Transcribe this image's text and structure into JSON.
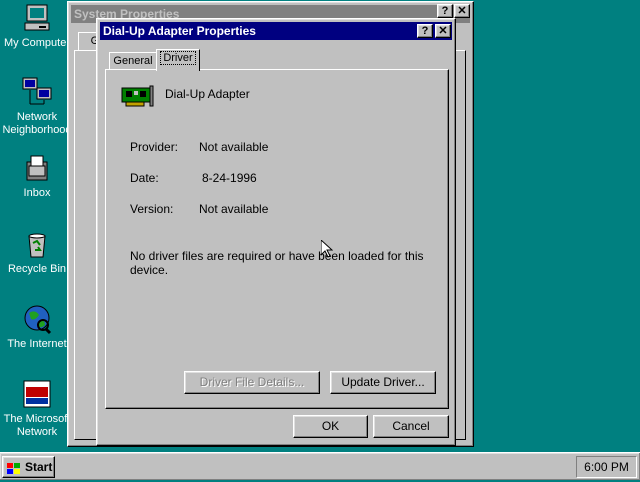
{
  "desktop": {
    "icons": [
      {
        "label": "My Computer"
      },
      {
        "label": "Network Neighborhood"
      },
      {
        "label": "Inbox"
      },
      {
        "label": "Recycle Bin"
      },
      {
        "label": "The Internet"
      },
      {
        "label": "The Microsoft Network"
      }
    ]
  },
  "system_properties": {
    "title": "System Properties",
    "tab_partial": "Ge",
    "help_btn": "?",
    "close_btn": "✕"
  },
  "dialog": {
    "title": "Dial-Up Adapter Properties",
    "help_btn": "?",
    "close_btn": "✕",
    "tabs": [
      {
        "label": "General"
      },
      {
        "label": "Driver"
      }
    ],
    "active_tab": "Driver",
    "device_name": "Dial-Up Adapter",
    "provider_label": "Provider:",
    "provider_value": "Not available",
    "date_label": "Date:",
    "date_value": "8-24-1996",
    "version_label": "Version:",
    "version_value": "Not available",
    "message": "No driver files are required or have been loaded for this device.",
    "driver_details_btn": "Driver File Details...",
    "update_driver_btn": "Update Driver...",
    "ok_btn": "OK",
    "cancel_btn": "Cancel"
  },
  "taskbar": {
    "start_label": "Start",
    "clock": "6:00 PM"
  },
  "colors": {
    "desktop": "#008080",
    "title_active": "#000080",
    "title_inactive": "#808080",
    "face": "#c0c0c0"
  }
}
